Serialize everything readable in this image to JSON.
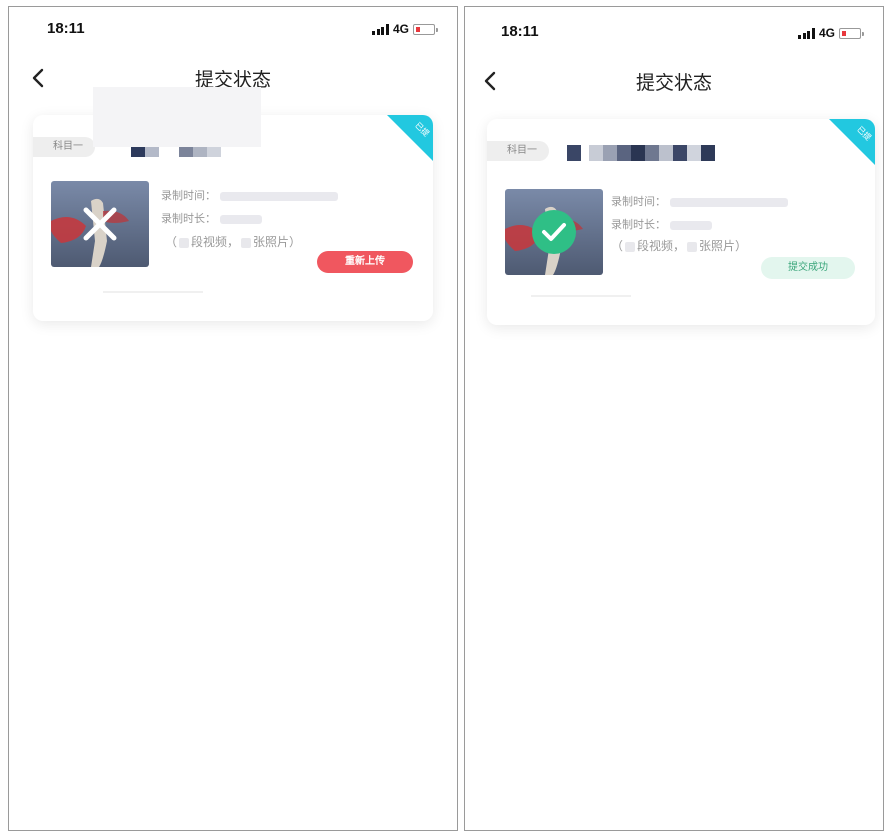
{
  "screens": [
    {
      "status_bar": {
        "time": "18:11",
        "network": "4G"
      },
      "nav": {
        "title": "提交状态"
      },
      "card": {
        "ribbon_text": "已提",
        "subject_tag": "科目一",
        "record_time_label": "录制时间：",
        "record_duration_label": "录制时长：",
        "media_open": "（",
        "media_videos": "段视频，",
        "media_photos": "张照片）",
        "action_label": "重新上传",
        "thumbnail_status": "failed"
      }
    },
    {
      "status_bar": {
        "time": "18:11",
        "network": "4G"
      },
      "nav": {
        "title": "提交状态"
      },
      "card": {
        "ribbon_text": "已提",
        "subject_tag": "科目一",
        "record_time_label": "录制时间：",
        "record_duration_label": "录制时长：",
        "media_open": "（",
        "media_videos": "段视频，",
        "media_photos": "张照片）",
        "action_label": "提交成功",
        "thumbnail_status": "success"
      }
    }
  ],
  "colors": {
    "ribbon": "#22c8e0",
    "reupload_button": "#f0575f",
    "success_button_bg": "#e3f6ee",
    "success_button_text": "#3aa57a",
    "success_check": "#2fbf86",
    "battery_low": "#e8383d"
  },
  "icons": {
    "back": "chevron-left-icon",
    "failed": "close-icon",
    "success": "check-circle-icon",
    "signal": "signal-icon",
    "battery": "battery-icon"
  }
}
